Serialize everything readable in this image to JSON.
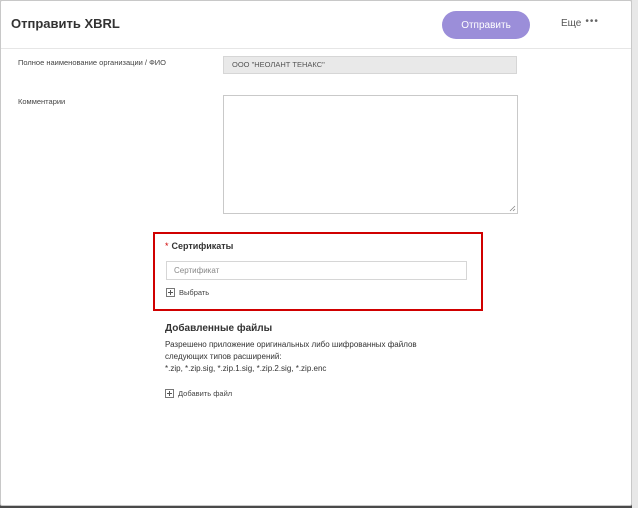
{
  "dialog": {
    "title": "Отправить XBRL",
    "send_label": "Отправить",
    "more_label": "Еще",
    "more_icon": "•••"
  },
  "form": {
    "org_label": "Полное наименование организации / ФИО",
    "org_value": "ООО \"НЕОЛАНТ ТЕНАКС\"",
    "comment_label": "Комментарии",
    "comment_value": ""
  },
  "certificates": {
    "required_mark": "*",
    "title": "Сертификаты",
    "placeholder": "Сертификат",
    "choose_label": "Выбрать",
    "highlight_color": "#d00000"
  },
  "files": {
    "title": "Добавленные файлы",
    "desc_line1": "Разрешено приложение оригинальных либо шифрованных файлов",
    "desc_line2": "следующих типов расширений:",
    "desc_line3": "*.zip, *.zip.sig, *.zip.1.sig, *.zip.2.sig, *.zip.enc",
    "add_label": "Добавить файл"
  },
  "colors": {
    "accent": "#9b8ed9"
  }
}
